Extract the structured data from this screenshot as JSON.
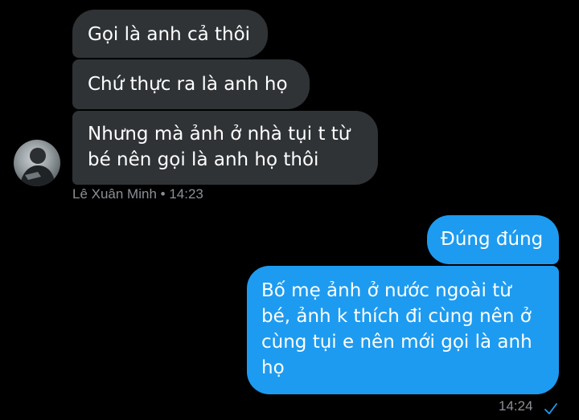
{
  "incoming": {
    "messages": [
      "Gọi là anh cả thôi",
      "Chứ thực ra là anh họ",
      "Nhưng mà ảnh ở nhà tụi t từ\nbé nên gọi là anh họ thôi"
    ],
    "sender_name": "Lê Xuân Minh",
    "separator": "•",
    "time": "14:23"
  },
  "outgoing": {
    "messages": [
      "Đúng đúng",
      "Bố mẹ ảnh ở nước ngoài từ\nbé, ảnh k thích đi cùng nên ở\ncùng tụi e nên mới gọi là anh\nhọ"
    ],
    "time": "14:24",
    "status_icon": "check-icon"
  },
  "colors": {
    "background": "#000000",
    "incoming_bubble": "#2f3336",
    "outgoing_bubble": "#1d9bf0",
    "meta_text": "#8b9096"
  }
}
